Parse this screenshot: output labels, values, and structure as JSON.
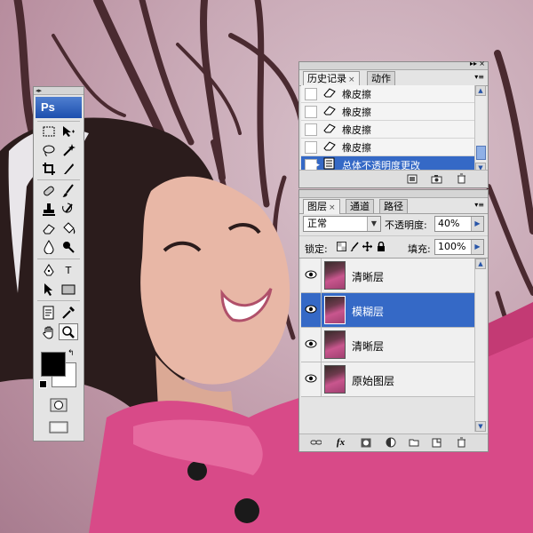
{
  "app": {
    "logo": "Ps"
  },
  "history_panel": {
    "tabs": [
      {
        "label": "历史记录",
        "active": true
      },
      {
        "label": "动作",
        "active": false
      }
    ],
    "items": [
      {
        "label": "橡皮擦",
        "icon": "eraser-icon",
        "selected": false
      },
      {
        "label": "橡皮擦",
        "icon": "eraser-icon",
        "selected": false
      },
      {
        "label": "橡皮擦",
        "icon": "eraser-icon",
        "selected": false
      },
      {
        "label": "橡皮擦",
        "icon": "eraser-icon",
        "selected": false
      },
      {
        "label": "总体不透明度更改",
        "icon": "layer-properties-icon",
        "selected": true
      }
    ],
    "close_symbol": "×",
    "footer_icons": [
      "new-document-from-state-icon",
      "new-snapshot-icon",
      "trash-icon"
    ]
  },
  "layers_panel": {
    "tabs": [
      {
        "label": "图层",
        "active": true
      },
      {
        "label": "通道",
        "active": false
      },
      {
        "label": "路径",
        "active": false
      }
    ],
    "close_symbol": "×",
    "blend_mode": "正常",
    "opacity_label": "不透明度:",
    "opacity_value": "40%",
    "lock_label": "锁定:",
    "fill_label": "填充:",
    "fill_value": "100%",
    "layers": [
      {
        "name": "清晰层",
        "visible": true,
        "selected": false
      },
      {
        "name": "模糊层",
        "visible": true,
        "selected": true
      },
      {
        "name": "清晰层",
        "visible": true,
        "selected": false
      },
      {
        "name": "原始图层",
        "visible": true,
        "selected": false
      }
    ],
    "footer_icons": [
      "link-layers-icon",
      "fx-icon",
      "layer-mask-icon",
      "adjustment-layer-icon",
      "new-group-icon",
      "new-layer-icon",
      "trash-icon"
    ],
    "fx_text": "fx"
  },
  "tools_panel": {
    "text_tool_glyph": "T",
    "foreground_color": "#000000",
    "background_color": "#ffffff"
  },
  "colors": {
    "selection": "#3569c6",
    "panel": "#e4e4e4",
    "pink_jacket": "#d84a88"
  }
}
